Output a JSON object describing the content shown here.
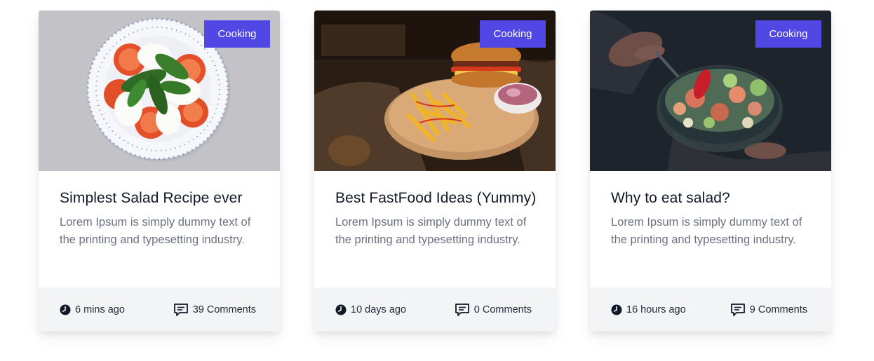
{
  "colors": {
    "accent": "#5147e5",
    "footer_bg": "#f3f4f6",
    "title": "#111827",
    "text": "#6b7280"
  },
  "cards": [
    {
      "category": "Cooking",
      "title": "Simplest Salad Recipe ever",
      "excerpt": "Lorem Ipsum is simply dummy text of the printing and typesetting industry.",
      "time": "6 mins ago",
      "comments": "39 Comments",
      "image": "caprese-salad-photo"
    },
    {
      "category": "Cooking",
      "title": "Best FastFood Ideas (Yummy)",
      "excerpt": "Lorem Ipsum is simply dummy text of the printing and typesetting industry.",
      "time": "10 days ago",
      "comments": "0 Comments",
      "image": "burger-and-fries-photo"
    },
    {
      "category": "Cooking",
      "title": "Why to eat salad?",
      "excerpt": "Lorem Ipsum is simply dummy text of the printing and typesetting industry.",
      "time": "16 hours ago",
      "comments": "9 Comments",
      "image": "pasta-salad-bowl-photo"
    }
  ],
  "icons": {
    "time": "clock-icon",
    "comments": "comment-icon"
  }
}
